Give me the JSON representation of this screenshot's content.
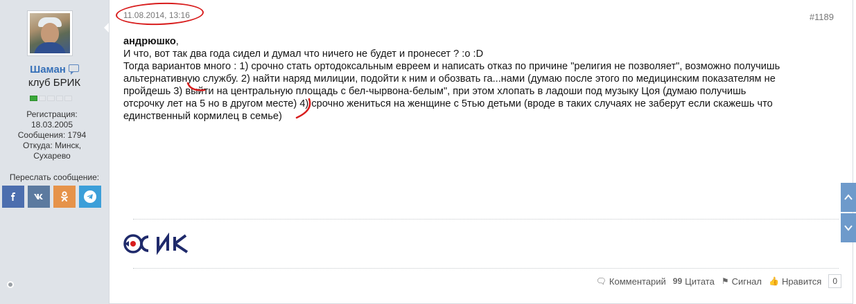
{
  "user": {
    "username": "Шаман",
    "title": "клуб БРИК",
    "reputation_level": 1,
    "reputation_max": 5,
    "info_lines": [
      "Регистрация:",
      "18.03.2005",
      "Сообщения: 1794",
      "Откуда: Минск,",
      "Сухарево"
    ],
    "share_label": "Переслать сообщение:",
    "share_buttons": [
      {
        "name": "facebook",
        "glyph": "f",
        "color": "#4c6eae"
      },
      {
        "name": "vkontakte",
        "glyph": "vk",
        "color": "#5c7a9f"
      },
      {
        "name": "odnoklassniki",
        "glyph": "ok",
        "color": "#e6934a"
      },
      {
        "name": "telegram",
        "glyph": "tg",
        "color": "#3c9fd9"
      }
    ]
  },
  "post": {
    "date": "11.08.2014, 13:16",
    "number": "#1189",
    "addressee": "андрюшко",
    "addressee_suffix": ",",
    "lines": [
      "И что, вот так два года сидел и думал что ничего не будет и пронесет ? :o :D",
      "Тогда вариантов много : 1) срочно стать ортодоксальным евреем и написать отказ по причине \"религия не позволяет\", возможно получишь",
      "альтернативную службу. 2) найти наряд милиции, подойти к ним и обозвать га...нами (думаю после этого по медицинским показателям не",
      "пройдешь 3) выйти на центральную площадь с бел-чырвона-белым\", при этом хлопать в ладоши под музыку Цоя (думаю получишь",
      "отсрочку лет на 5 но в другом месте) 4) срочно жениться на женщине с 5тью детьми (вроде в таких случаях не заберут если скажешь что",
      "единственный кормилец в семье)"
    ],
    "signature_logo": "БРИК",
    "actions": {
      "comment": "Комментарий",
      "quote": "Цитата",
      "report": "Сигнал",
      "like": "Нравится",
      "like_count": "0"
    }
  },
  "colors": {
    "accent": "#3670b8",
    "annotation": "#d81d1d",
    "sidebar_bg": "#dfe3e8"
  }
}
